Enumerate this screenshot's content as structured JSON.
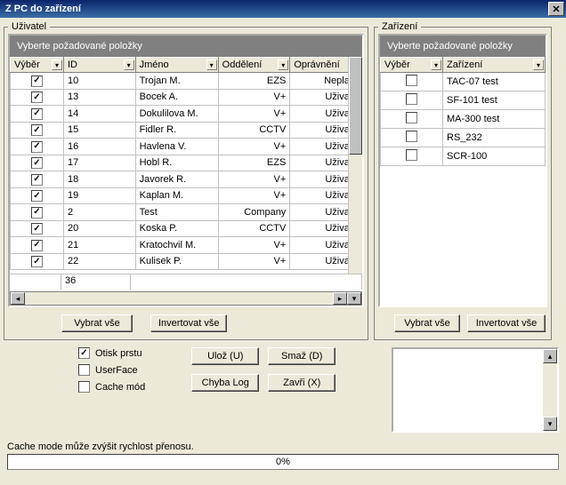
{
  "title": "Z PC do zařízení",
  "user_group": {
    "legend": "Uživatel",
    "banner": "Vyberte požadované položky",
    "columns": [
      "Výběr",
      "ID",
      "Jméno",
      "Oddělení",
      "Oprávnění"
    ],
    "rows": [
      {
        "checked": true,
        "id": "10",
        "name": "Trojan M.",
        "dept": "EZS",
        "perm": "Neplatn"
      },
      {
        "checked": true,
        "id": "13",
        "name": "Bocek A.",
        "dept": "V+",
        "perm": "Uživate"
      },
      {
        "checked": true,
        "id": "14",
        "name": "Dokulilova M.",
        "dept": "V+",
        "perm": "Uživate"
      },
      {
        "checked": true,
        "id": "15",
        "name": "Fidler R.",
        "dept": "CCTV",
        "perm": "Uživate"
      },
      {
        "checked": true,
        "id": "16",
        "name": "Havlena V.",
        "dept": "V+",
        "perm": "Uživate"
      },
      {
        "checked": true,
        "id": "17",
        "name": "Hobl R.",
        "dept": "EZS",
        "perm": "Uživate"
      },
      {
        "checked": true,
        "id": "18",
        "name": "Javorek R.",
        "dept": "V+",
        "perm": "Uživate"
      },
      {
        "checked": true,
        "id": "19",
        "name": "Kaplan M.",
        "dept": "V+",
        "perm": "Uživate"
      },
      {
        "checked": true,
        "id": "2",
        "name": "Test",
        "dept": "Company",
        "perm": "Uživate"
      },
      {
        "checked": true,
        "id": "20",
        "name": "Koska P.",
        "dept": "CCTV",
        "perm": "Uživate"
      },
      {
        "checked": true,
        "id": "21",
        "name": "Kratochvil M.",
        "dept": "V+",
        "perm": "Uživate"
      },
      {
        "checked": true,
        "id": "22",
        "name": "Kulisek P.",
        "dept": "V+",
        "perm": "Uživate"
      }
    ],
    "footer_count": "36",
    "select_all": "Vybrat vše",
    "invert_all": "Invertovat vše"
  },
  "device_group": {
    "legend": "Zařízení",
    "banner": "Vyberte požadované položky",
    "columns": [
      "Výběr",
      "Zařízení"
    ],
    "rows": [
      {
        "checked": false,
        "name": "TAC-07 test"
      },
      {
        "checked": false,
        "name": "SF-101 test"
      },
      {
        "checked": false,
        "name": "MA-300 test"
      },
      {
        "checked": false,
        "name": "RS_232"
      },
      {
        "checked": false,
        "name": "SCR-100"
      }
    ],
    "select_all": "Vybrat vše",
    "invert_all": "Invertovat vše"
  },
  "options": {
    "fingerprint": {
      "label": "Otisk prstu",
      "checked": true
    },
    "userface": {
      "label": "UserFace",
      "checked": false
    },
    "cache": {
      "label": "Cache mód",
      "checked": false
    }
  },
  "buttons": {
    "save": "Ulož (U)",
    "delete": "Smaž (D)",
    "errorlog": "Chyba Log",
    "close": "Zavři (X)"
  },
  "cache_note": "Cache mode může zvýšit rychlost přenosu.",
  "progress_text": "0%"
}
